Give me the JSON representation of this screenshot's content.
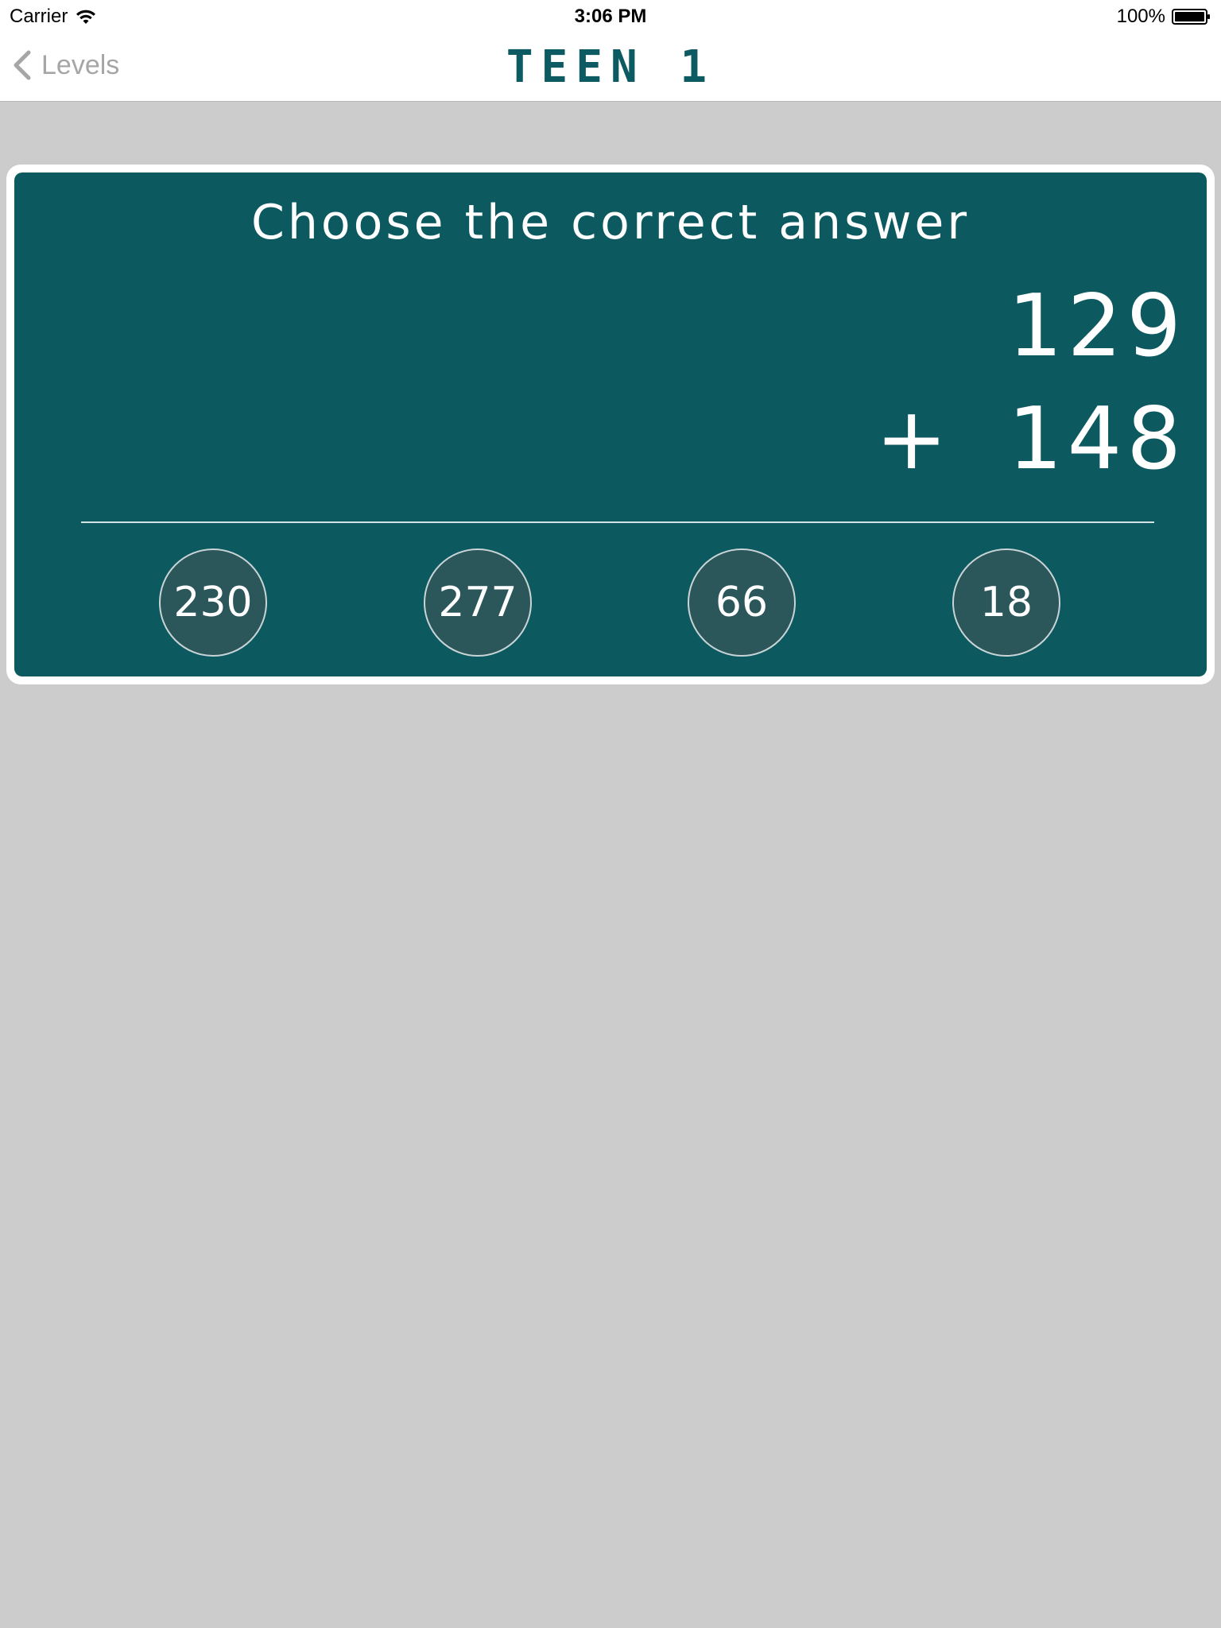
{
  "status_bar": {
    "carrier": "Carrier",
    "time": "3:06 PM",
    "battery": "100%"
  },
  "nav": {
    "back_label": "Levels",
    "title": "TEEN 1"
  },
  "quiz": {
    "prompt": "Choose the correct answer",
    "operand_top": "129",
    "operator": "+",
    "operand_bottom": "148",
    "answers": [
      "230",
      "277",
      "66",
      "18"
    ]
  },
  "colors": {
    "background": "#cccccc",
    "board": "#0c5960",
    "title": "#0c5a62",
    "answer_circle": "#2b565a"
  }
}
